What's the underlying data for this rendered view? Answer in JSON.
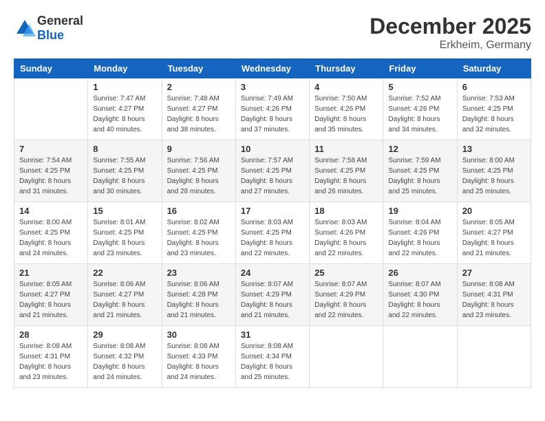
{
  "header": {
    "logo_general": "General",
    "logo_blue": "Blue",
    "month": "December 2025",
    "location": "Erkheim, Germany"
  },
  "weekdays": [
    "Sunday",
    "Monday",
    "Tuesday",
    "Wednesday",
    "Thursday",
    "Friday",
    "Saturday"
  ],
  "weeks": [
    [
      {
        "day": "",
        "info": ""
      },
      {
        "day": "1",
        "info": "Sunrise: 7:47 AM\nSunset: 4:27 PM\nDaylight: 8 hours\nand 40 minutes."
      },
      {
        "day": "2",
        "info": "Sunrise: 7:48 AM\nSunset: 4:27 PM\nDaylight: 8 hours\nand 38 minutes."
      },
      {
        "day": "3",
        "info": "Sunrise: 7:49 AM\nSunset: 4:26 PM\nDaylight: 8 hours\nand 37 minutes."
      },
      {
        "day": "4",
        "info": "Sunrise: 7:50 AM\nSunset: 4:26 PM\nDaylight: 8 hours\nand 35 minutes."
      },
      {
        "day": "5",
        "info": "Sunrise: 7:52 AM\nSunset: 4:26 PM\nDaylight: 8 hours\nand 34 minutes."
      },
      {
        "day": "6",
        "info": "Sunrise: 7:53 AM\nSunset: 4:25 PM\nDaylight: 8 hours\nand 32 minutes."
      }
    ],
    [
      {
        "day": "7",
        "info": "Sunrise: 7:54 AM\nSunset: 4:25 PM\nDaylight: 8 hours\nand 31 minutes."
      },
      {
        "day": "8",
        "info": "Sunrise: 7:55 AM\nSunset: 4:25 PM\nDaylight: 8 hours\nand 30 minutes."
      },
      {
        "day": "9",
        "info": "Sunrise: 7:56 AM\nSunset: 4:25 PM\nDaylight: 8 hours\nand 28 minutes."
      },
      {
        "day": "10",
        "info": "Sunrise: 7:57 AM\nSunset: 4:25 PM\nDaylight: 8 hours\nand 27 minutes."
      },
      {
        "day": "11",
        "info": "Sunrise: 7:58 AM\nSunset: 4:25 PM\nDaylight: 8 hours\nand 26 minutes."
      },
      {
        "day": "12",
        "info": "Sunrise: 7:59 AM\nSunset: 4:25 PM\nDaylight: 8 hours\nand 25 minutes."
      },
      {
        "day": "13",
        "info": "Sunrise: 8:00 AM\nSunset: 4:25 PM\nDaylight: 8 hours\nand 25 minutes."
      }
    ],
    [
      {
        "day": "14",
        "info": "Sunrise: 8:00 AM\nSunset: 4:25 PM\nDaylight: 8 hours\nand 24 minutes."
      },
      {
        "day": "15",
        "info": "Sunrise: 8:01 AM\nSunset: 4:25 PM\nDaylight: 8 hours\nand 23 minutes."
      },
      {
        "day": "16",
        "info": "Sunrise: 8:02 AM\nSunset: 4:25 PM\nDaylight: 8 hours\nand 23 minutes."
      },
      {
        "day": "17",
        "info": "Sunrise: 8:03 AM\nSunset: 4:25 PM\nDaylight: 8 hours\nand 22 minutes."
      },
      {
        "day": "18",
        "info": "Sunrise: 8:03 AM\nSunset: 4:26 PM\nDaylight: 8 hours\nand 22 minutes."
      },
      {
        "day": "19",
        "info": "Sunrise: 8:04 AM\nSunset: 4:26 PM\nDaylight: 8 hours\nand 22 minutes."
      },
      {
        "day": "20",
        "info": "Sunrise: 8:05 AM\nSunset: 4:27 PM\nDaylight: 8 hours\nand 21 minutes."
      }
    ],
    [
      {
        "day": "21",
        "info": "Sunrise: 8:05 AM\nSunset: 4:27 PM\nDaylight: 8 hours\nand 21 minutes."
      },
      {
        "day": "22",
        "info": "Sunrise: 8:06 AM\nSunset: 4:27 PM\nDaylight: 8 hours\nand 21 minutes."
      },
      {
        "day": "23",
        "info": "Sunrise: 8:06 AM\nSunset: 4:28 PM\nDaylight: 8 hours\nand 21 minutes."
      },
      {
        "day": "24",
        "info": "Sunrise: 8:07 AM\nSunset: 4:29 PM\nDaylight: 8 hours\nand 21 minutes."
      },
      {
        "day": "25",
        "info": "Sunrise: 8:07 AM\nSunset: 4:29 PM\nDaylight: 8 hours\nand 22 minutes."
      },
      {
        "day": "26",
        "info": "Sunrise: 8:07 AM\nSunset: 4:30 PM\nDaylight: 8 hours\nand 22 minutes."
      },
      {
        "day": "27",
        "info": "Sunrise: 8:08 AM\nSunset: 4:31 PM\nDaylight: 8 hours\nand 23 minutes."
      }
    ],
    [
      {
        "day": "28",
        "info": "Sunrise: 8:08 AM\nSunset: 4:31 PM\nDaylight: 8 hours\nand 23 minutes."
      },
      {
        "day": "29",
        "info": "Sunrise: 8:08 AM\nSunset: 4:32 PM\nDaylight: 8 hours\nand 24 minutes."
      },
      {
        "day": "30",
        "info": "Sunrise: 8:08 AM\nSunset: 4:33 PM\nDaylight: 8 hours\nand 24 minutes."
      },
      {
        "day": "31",
        "info": "Sunrise: 8:08 AM\nSunset: 4:34 PM\nDaylight: 8 hours\nand 25 minutes."
      },
      {
        "day": "",
        "info": ""
      },
      {
        "day": "",
        "info": ""
      },
      {
        "day": "",
        "info": ""
      }
    ]
  ]
}
